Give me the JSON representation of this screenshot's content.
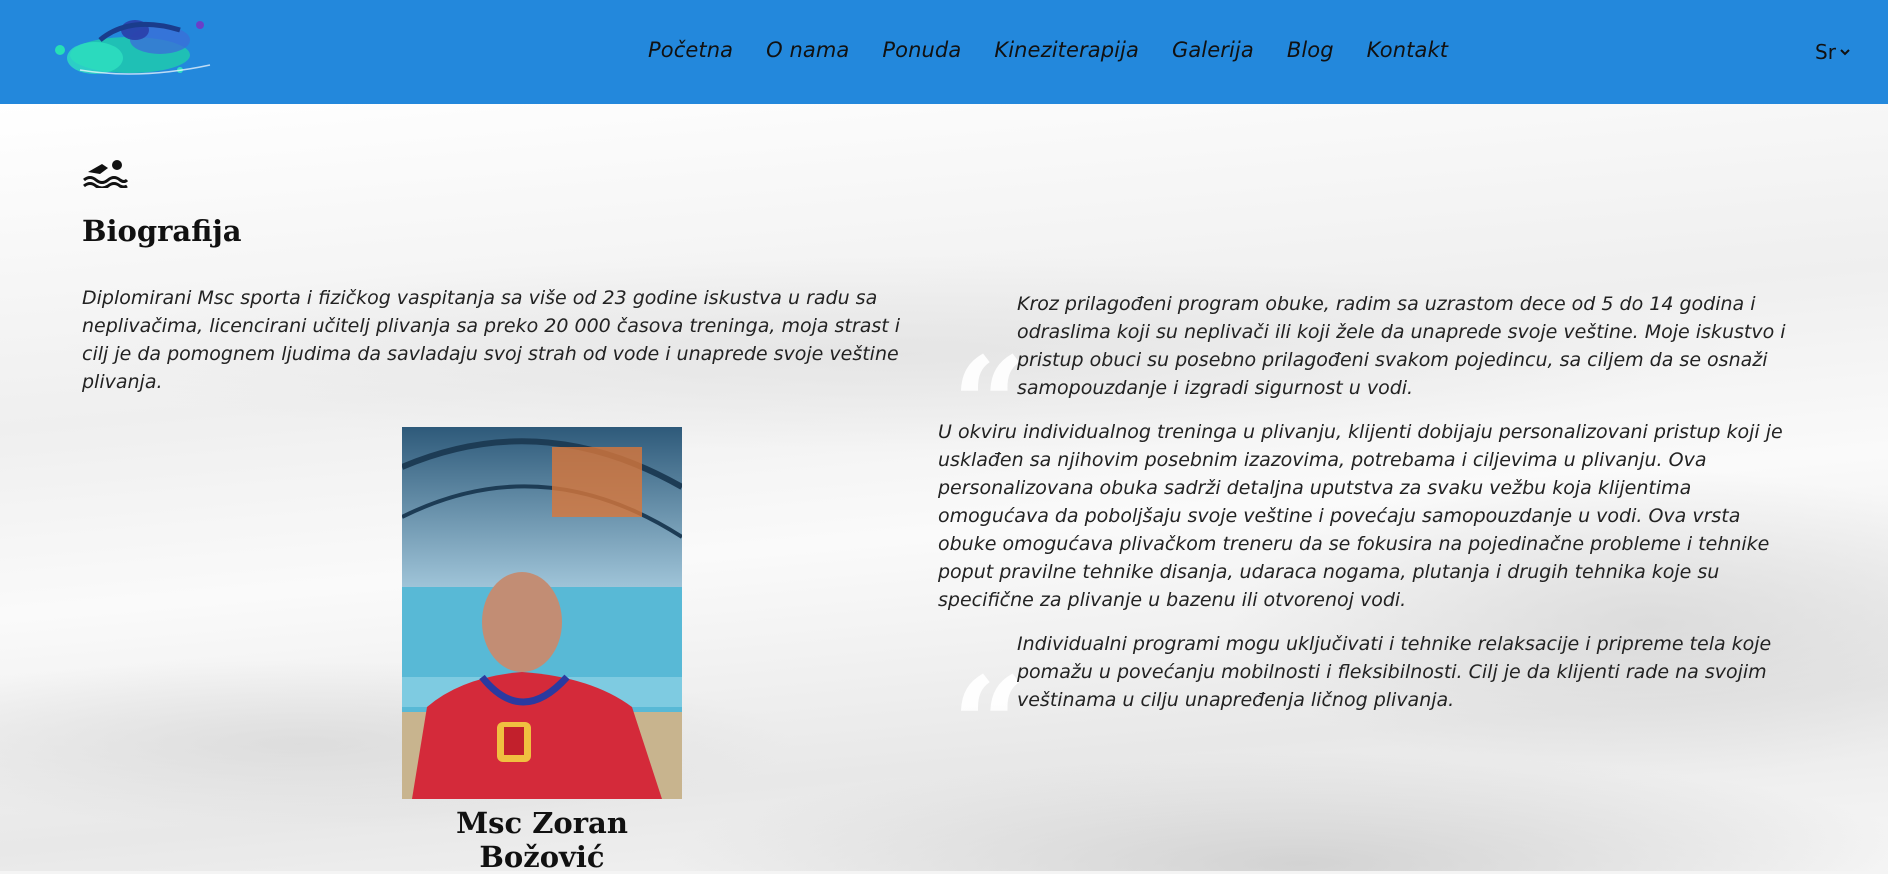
{
  "nav": {
    "items": [
      "Početna",
      "O nama",
      "Ponuda",
      "Kineziterapija",
      "Galerija",
      "Blog",
      "Kontakt"
    ],
    "language": "Sr"
  },
  "bio": {
    "title": "Biografija",
    "intro": "Diplomirani Msc sporta i fizičkog vaspitanja sa više od 23 godine iskustva u radu sa neplivačima, licencirani učitelj plivanja sa preko 20 000 časova treninga, moja strast i cilj je da pomognem ljudima da savladaju svoj strah od vode i unaprede svoje veštine plivanja.",
    "name": "Msc Zoran Božović"
  },
  "right": {
    "quote1": "Kroz prilagođeni program obuke, radim sa uzrastom dece od 5 do 14 godina i odraslima koji su neplivači ili koji žele da unaprede svoje veštine. Moje iskustvo i pristup obuci su posebno prilagođeni svakom pojedincu, sa ciljem da se osnaži samopouzdanje i izgradi sigurnost u vodi.",
    "paragraph": "U okviru individualnog treninga u plivanju, klijenti dobijaju personalizovani pristup koji je usklađen sa njihovim posebnim izazovima, potrebama i ciljevima u plivanju. Ova personalizovana obuka sadrži detaljna uputstva za svaku vežbu koja klijentima omogućava da poboljšaju svoje veštine i povećaju samopouzdanje u vodi. Ova vrsta obuke omogućava plivačkom treneru da se fokusira na pojedinačne probleme i tehnike poput pravilne tehnike disanja, udaraca nogama, plutanja i drugih tehnika koje su specifične za plivanje u bazenu ili otvorenoj vodi.",
    "quote2": "Individualni programi mogu uključivati i tehnike relaksacije i pripreme tela koje pomažu u povećanju mobilnosti i fleksibilnosti. Cilj je da klijenti rade na svojim veštinama u cilju unapređenja ličnog plivanja."
  },
  "icons": {
    "logo": "swimmer-splash-logo",
    "section": "swimmer-icon",
    "language_toggle": "chevron-down-icon",
    "quote": "quote-icon"
  },
  "colors": {
    "header": "#2388dc",
    "text": "#222222"
  }
}
